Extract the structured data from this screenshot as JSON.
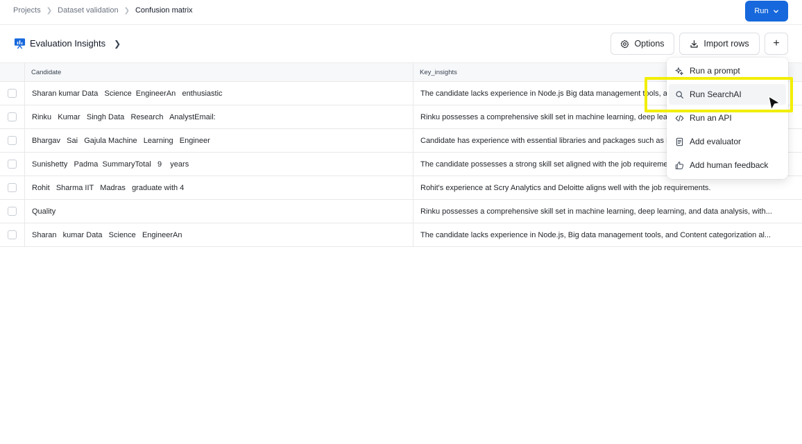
{
  "breadcrumb": {
    "items": [
      "Projects",
      "Dataset validation",
      "Confusion matrix"
    ]
  },
  "run_button": {
    "label": "Run"
  },
  "header": {
    "title": "Evaluation Insights",
    "options_label": "Options",
    "import_label": "Import rows",
    "add_symbol": "+"
  },
  "table": {
    "columns": [
      "Candidate",
      "Key_insights"
    ],
    "rows": [
      {
        "candidate": "Sharan kumar Data   Science  EngineerAn   enthusiastic",
        "insight": "The candidate lacks experience in Node.js Big data management tools, and Content categorization al..."
      },
      {
        "candidate": "Rinku   Kumar   Singh Data   Research   AnalystEmail:",
        "insight": "Rinku possesses a comprehensive skill set in machine learning, deep learning, and data analysis, with..."
      },
      {
        "candidate": "Bhargav   Sai   Gajula Machine   Learning   Engineer",
        "insight": "Candidate has experience with essential libraries and packages such as NumPy, Pandas, and Scikit-l..."
      },
      {
        "candidate": "Sunishetty   Padma  SummaryTotal   9    years",
        "insight": "The candidate possesses a strong skill set aligned with the job requirements and responsibilities..."
      },
      {
        "candidate": "Rohit   Sharma IIT   Madras   graduate with 4",
        "insight": "Rohit's experience at Scry Analytics and Deloitte aligns well with the job requirements."
      },
      {
        "candidate": "Quality",
        "insight": "Rinku possesses a comprehensive skill set in machine learning, deep learning, and data analysis, with..."
      },
      {
        "candidate": "Sharan   kumar Data   Science   EngineerAn",
        "insight": "The candidate lacks experience in Node.js, Big data management tools, and Content categorization al..."
      }
    ]
  },
  "menu": {
    "items": [
      {
        "label": "Run a prompt",
        "icon": "sparkle-icon"
      },
      {
        "label": "Run SearchAI",
        "icon": "search-icon"
      },
      {
        "label": "Run an API",
        "icon": "code-icon"
      },
      {
        "label": "Add evaluator",
        "icon": "document-icon"
      },
      {
        "label": "Add human feedback",
        "icon": "thumbs-up-icon"
      }
    ]
  },
  "colors": {
    "primary": "#1668dc",
    "highlight": "#f2ee00",
    "brand_icon": "#1668dc"
  }
}
